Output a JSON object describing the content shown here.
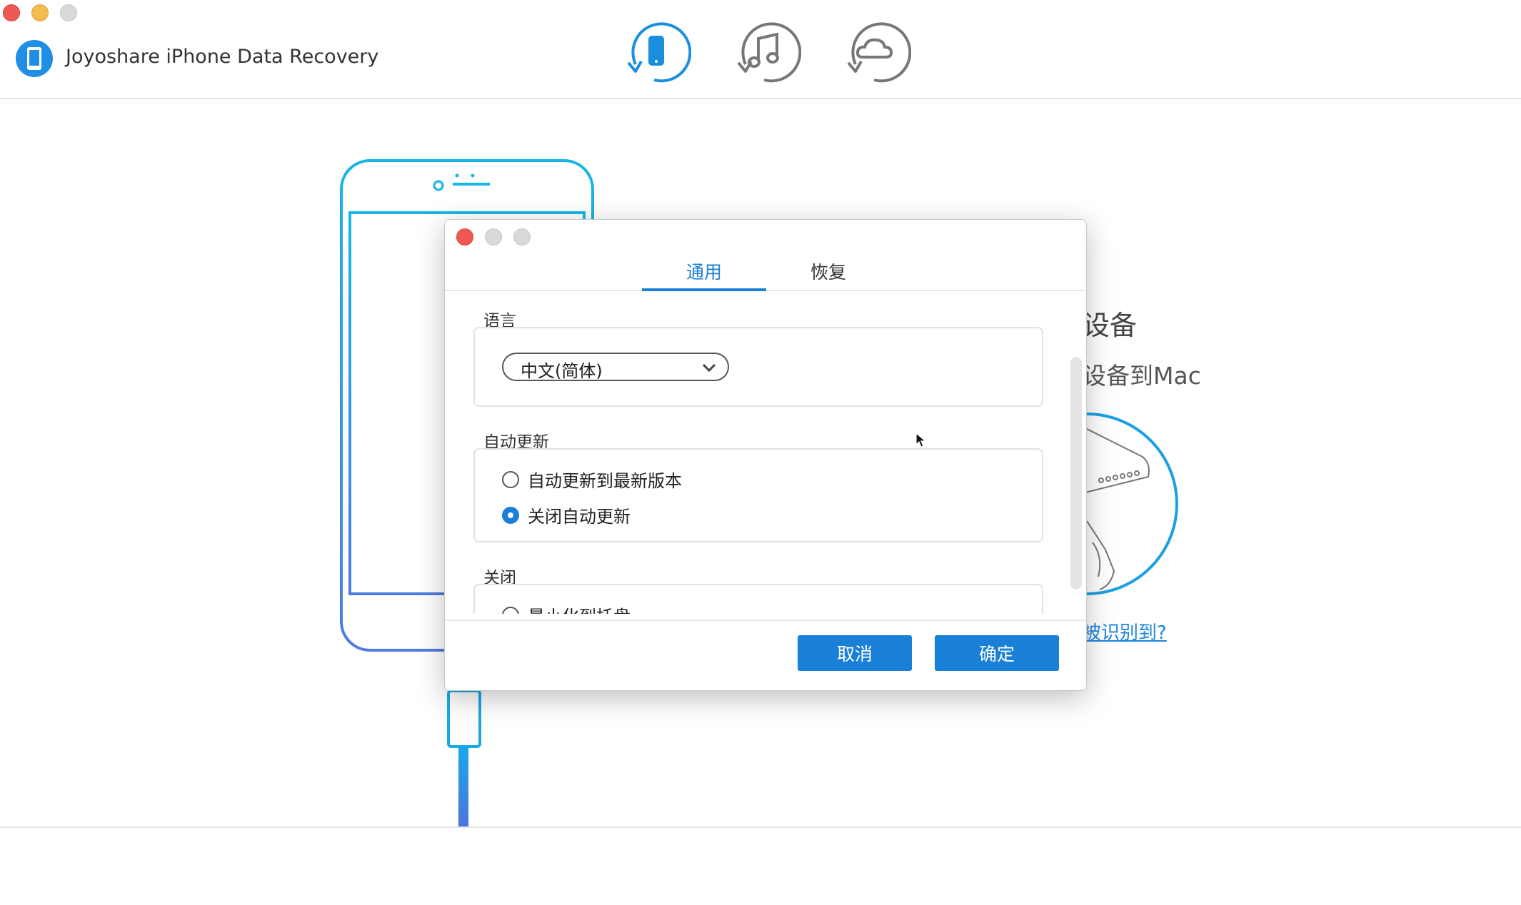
{
  "app": {
    "title": "Joyoshare iPhone Data Recovery",
    "modes": [
      {
        "name": "recover-from-device",
        "active": true
      },
      {
        "name": "recover-from-itunes",
        "active": false
      },
      {
        "name": "recover-from-icloud",
        "active": false
      }
    ]
  },
  "background": {
    "heading": "设备",
    "subheading": "设备到Mac",
    "help_link": "被识别到?"
  },
  "dialog": {
    "tabs": [
      {
        "label": "通用",
        "active": true
      },
      {
        "label": "恢复",
        "active": false
      }
    ],
    "sections": {
      "language": {
        "label": "语言",
        "selected": "中文(简体)"
      },
      "auto_update": {
        "label": "自动更新",
        "options": [
          {
            "label": "自动更新到最新版本",
            "checked": false
          },
          {
            "label": "关闭自动更新",
            "checked": true
          }
        ]
      },
      "close": {
        "label": "关闭",
        "options": [
          {
            "label": "最小化到托盘",
            "checked": false
          }
        ]
      }
    },
    "buttons": {
      "cancel": "取消",
      "ok": "确定"
    }
  },
  "colors": {
    "accent": "#1a7fd6",
    "illustration": "#1aa0e6"
  }
}
